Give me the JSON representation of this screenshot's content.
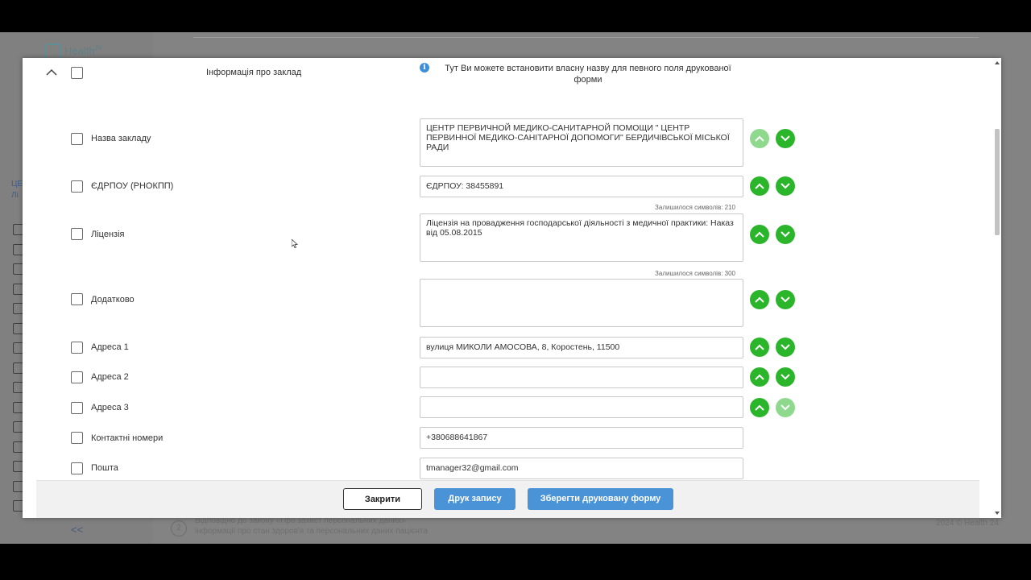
{
  "background": {
    "logo": "Health",
    "logo_sup": "24",
    "side_label_1": "ЦЕ",
    "side_label_2": "Лі",
    "collapse": "<<",
    "footer_line_1": "Відповідно до закону «Про захист персональних даних»",
    "footer_line_2": "інформації про стан здоров'я та персональних даних пацієнта",
    "copyright": "2024 © Health 24",
    "step_number": "2"
  },
  "modal": {
    "header_title": "Інформація про заклад",
    "info_text": "Тут Ви можете встановити власну назву для певного поля друкованої форми",
    "rows": [
      {
        "label": "Назва закладу",
        "value": "ЦЕНТР ПЕРВИЧНОЙ МЕДИКО-САНИТАРНОЙ ПОМОЩИ  \" ЦЕНТР ПЕРВИННОЇ МЕДИКО-САНІТАРНОЇ ДОПОМОГИ\" БЕРДИЧІВСЬКОЇ МІСЬКОЇ РАДИ"
      },
      {
        "label": "ЄДРПОУ (РНОКПП)",
        "value": "ЄДРПОУ: 38455891"
      },
      {
        "label": "Ліцензія",
        "value": "Ліцензія на провадження господарської діяльності з медичної практики: Наказ від 05.08.2015",
        "remaining": "Залишилося символів: 210"
      },
      {
        "label": "Додатково",
        "value": "",
        "remaining": "Залишилося символів: 300"
      },
      {
        "label": "Адреса 1",
        "value": "вулиця МИКОЛИ АМОСОВА, 8, Коростень, 11500"
      },
      {
        "label": "Адреса 2",
        "value": ""
      },
      {
        "label": "Адреса 3",
        "value": ""
      },
      {
        "label": "Контактні номери",
        "value": "+380688641867"
      },
      {
        "label": "Пошта",
        "value": "tmanager32@gmail.com"
      }
    ],
    "buttons": {
      "close": "Закрити",
      "print": "Друк запису",
      "save": "Зберегти друковану форму"
    }
  },
  "colors": {
    "move_button": "#2bb52b",
    "move_button_disabled": "#8fd98f",
    "primary_button": "#4a93d6"
  }
}
